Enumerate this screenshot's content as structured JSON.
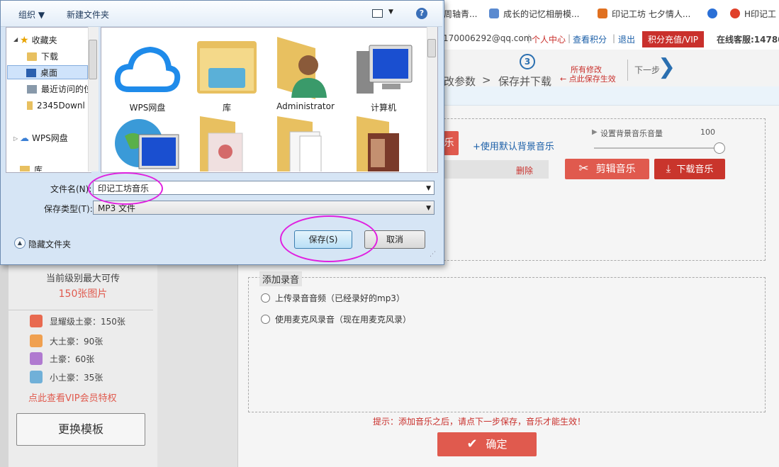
{
  "bookmarks": [
    {
      "label": "周轴青...",
      "color": "#c9302c"
    },
    {
      "label": "成长的记忆相册模...",
      "color": "#5a8ad0"
    },
    {
      "label": "印记工坊 七夕情人...",
      "color": "#e07020"
    },
    {
      "label": "",
      "color": "#2a6fd6"
    },
    {
      "label": "H印记工",
      "color": "#e0402a"
    }
  ],
  "site_header": {
    "email": "170006292@qq.com",
    "sep": "|",
    "personal_center": "个人中心",
    "check_points": "查看积分",
    "logout": "退出",
    "vip_button": "积分充值/VIP",
    "online_service": "在线客服:147800"
  },
  "steps": {
    "step_number": "3",
    "params_tail": "改参数",
    "arrow": ">",
    "save_download": "保存并下载",
    "save_hint_line1": "所有修改",
    "save_hint_line2": "点此保存生效",
    "next_step": "下一步"
  },
  "left_panel": {
    "max_upload_label": "当前级别最大可传",
    "max_upload_value": "150张图片",
    "tiers": [
      {
        "label": "显耀级土豪：150张",
        "color": "#e86a50"
      },
      {
        "label": "大土豪：90张",
        "color": "#f0a050"
      },
      {
        "label": "土豪：60张",
        "color": "#b07ad0"
      },
      {
        "label": "小土豪：35张",
        "color": "#70b0d8"
      }
    ],
    "vip_link": "点此查看VIP会员特权",
    "change_template": "更换模板"
  },
  "music_modal": {
    "partial_button": "乐",
    "use_default_music": "+使用默认背景音乐",
    "volume_label": "设置背景音乐音量",
    "volume_value": 100,
    "delete_label": "删除",
    "edit_music": "剪辑音乐",
    "download_music": "下载音乐",
    "add_recording_title": "添加录音",
    "option_upload": "上传录音音频（已经录好的mp3）",
    "option_mic": "使用麦克风录音（现在用麦克风录）",
    "tip": "提示：添加音乐之后，请点下一步保存，音乐才能生效！",
    "confirm": "确定"
  },
  "save_dialog": {
    "toolbar_organize": "组织 ▼",
    "toolbar_new_folder": "新建文件夹",
    "help": "?",
    "nav_items": [
      {
        "label": "收藏夹",
        "icon": "star-icon"
      },
      {
        "label": "下载",
        "icon": "folder-icon"
      },
      {
        "label": "桌面",
        "icon": "desktop-icon"
      },
      {
        "label": "最近访问的位",
        "icon": "recent-icon"
      },
      {
        "label": "2345Downl",
        "icon": "folder-icon"
      },
      {
        "label": "WPS网盘",
        "icon": "cloud-icon"
      },
      {
        "label": "库",
        "icon": "library-icon"
      }
    ],
    "files": [
      {
        "label": "WPS网盘",
        "icon": "cloud-icon"
      },
      {
        "label": "库",
        "icon": "library-icon"
      },
      {
        "label": "Administrator",
        "icon": "user-folder-icon"
      },
      {
        "label": "计算机",
        "icon": "computer-icon"
      },
      {
        "label": "",
        "icon": "network-icon"
      },
      {
        "label": "",
        "icon": "folder-icon"
      },
      {
        "label": "",
        "icon": "folder-icon"
      },
      {
        "label": "",
        "icon": "folder-icon"
      }
    ],
    "filename_label": "文件名(N):",
    "filename_value": "印记工坊音乐",
    "filetype_label": "保存类型(T):",
    "filetype_value": "MP3 文件",
    "hide_folders": "隐藏文件夹",
    "save_button": "保存(S)",
    "cancel_button": "取消"
  }
}
